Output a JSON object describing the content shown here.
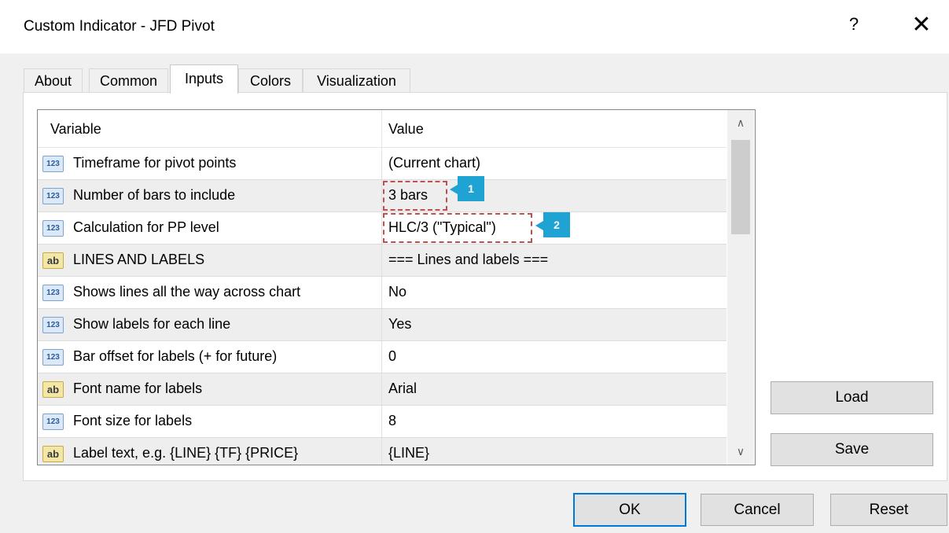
{
  "window": {
    "title": "Custom Indicator - JFD Pivot",
    "help_label": "?",
    "close_label": "✕"
  },
  "tabs": [
    {
      "label": "About"
    },
    {
      "label": "Common"
    },
    {
      "label": "Inputs"
    },
    {
      "label": "Colors"
    },
    {
      "label": "Visualization"
    }
  ],
  "active_tab": "Inputs",
  "grid": {
    "headers": {
      "variable": "Variable",
      "value": "Value"
    },
    "rows": [
      {
        "icon": "123",
        "variable": "Timeframe for pivot points",
        "value": "(Current chart)"
      },
      {
        "icon": "123",
        "variable": "Number of bars to include",
        "value": "3 bars"
      },
      {
        "icon": "123",
        "variable": "Calculation for PP level",
        "value": "HLC/3 (\"Typical\")"
      },
      {
        "icon": "ab",
        "variable": "LINES AND LABELS",
        "value": "=== Lines and labels ==="
      },
      {
        "icon": "123",
        "variable": "Shows lines all the way across chart",
        "value": "No"
      },
      {
        "icon": "123",
        "variable": "Show labels for each line",
        "value": "Yes"
      },
      {
        "icon": "123",
        "variable": "Bar offset for labels (+ for future)",
        "value": "0"
      },
      {
        "icon": "ab",
        "variable": "Font name for labels",
        "value": "Arial"
      },
      {
        "icon": "123",
        "variable": "Font size for labels",
        "value": "8"
      },
      {
        "icon": "ab",
        "variable": "Label text, e.g. {LINE} {TF} {PRICE}",
        "value": "{LINE}"
      }
    ]
  },
  "scrollbar": {
    "up_arrow": "∧",
    "down_arrow": "∨"
  },
  "annotations": [
    {
      "label": "1"
    },
    {
      "label": "2"
    }
  ],
  "buttons": {
    "load": "Load",
    "save": "Save",
    "ok": "OK",
    "cancel": "Cancel",
    "reset": "Reset"
  },
  "colors": {
    "highlight": "#c0504d",
    "marker": "#1fa3d3",
    "default_button_border": "#0078d7"
  }
}
